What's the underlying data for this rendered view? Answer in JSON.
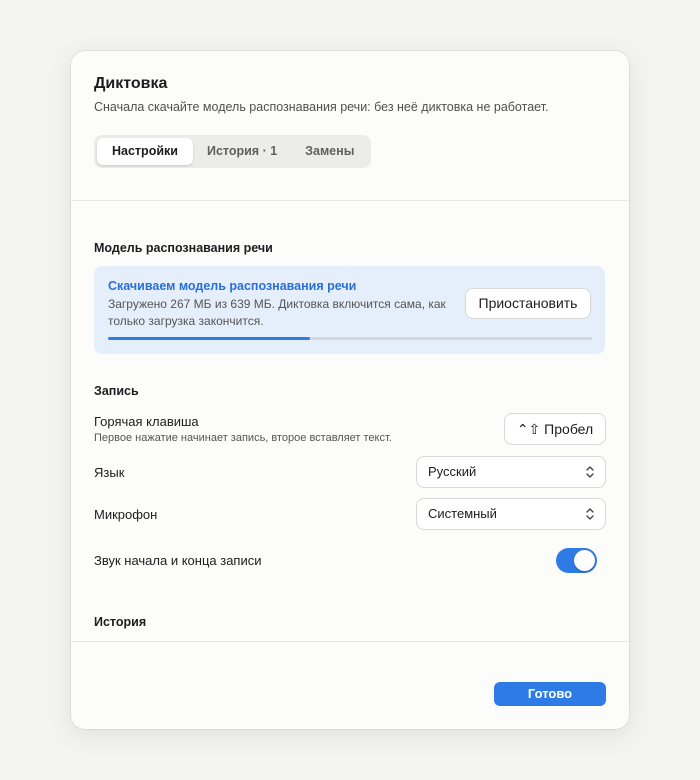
{
  "dialog": {
    "title": "Диктовка",
    "subtitle": "Сначала скачайте модель распознавания речи: без неё диктовка не работает."
  },
  "tabs": [
    {
      "label": "Настройки",
      "active": true
    },
    {
      "label": "История · 1",
      "active": false
    },
    {
      "label": "Замены",
      "active": false
    }
  ],
  "model_section": {
    "title": "Модель распознавания речи",
    "status_title": "Скачиваем модель распознавания речи",
    "status_desc": "Загружено 267 МБ из 639 МБ. Диктовка включится сама, как только загрузка закончится.",
    "pause_label": "Приостановить",
    "progress_fraction": 0.418
  },
  "recording_section": {
    "title": "Запись",
    "hotkey_label": "Горячая клавиша",
    "hotkey_hint": "Первое нажатие начинает запись, второе вставляет текст.",
    "hotkey_value": "⌃⇧ Пробел",
    "language_label": "Язык",
    "language_value": "Русский",
    "mic_label": "Микрофон",
    "mic_value": "Системный",
    "sound_label": "Звук начала и конца записи",
    "sound_enabled": true
  },
  "history_section": {
    "title": "История"
  },
  "footer": {
    "done_label": "Готово"
  },
  "colors": {
    "accent": "#2f7be6",
    "info_bg": "#e5eefb",
    "info_title": "#2a6fd6"
  },
  "icons": {
    "select_chevron": "chevron-up-down-icon"
  }
}
